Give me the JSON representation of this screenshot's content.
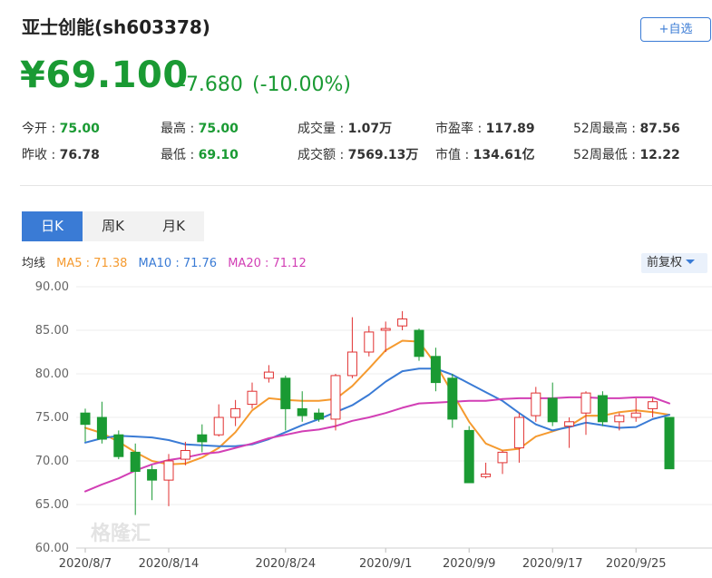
{
  "header": {
    "title": "亚士创能(sh603378)",
    "add_button": "+自选",
    "price": "¥69.100",
    "change": "-7.680",
    "change_pct": "(-10.00%)"
  },
  "stats": {
    "open_label": "今开 :",
    "open": "75.00",
    "high_label": "最高 :",
    "high": "75.00",
    "volume_label": "成交量 :",
    "volume": "1.07万",
    "pe_label": "市盈率 :",
    "pe": "117.89",
    "w52high_label": "52周最高 :",
    "w52high": "87.56",
    "prev_label": "昨收 :",
    "prev": "76.78",
    "low_label": "最低 :",
    "low": "69.10",
    "amount_label": "成交额 :",
    "amount": "7569.13万",
    "mcap_label": "市值 :",
    "mcap": "134.61亿",
    "w52low_label": "52周最低 :",
    "w52low": "12.22"
  },
  "tabs": {
    "day": "日K",
    "week": "周K",
    "month": "月K"
  },
  "ma_legend": {
    "label": "均线",
    "ma5": "MA5 : 71.38",
    "ma10": "MA10 : 71.76",
    "ma20": "MA20 : 71.12"
  },
  "adjust_select": "前复权",
  "watermark": "格隆汇",
  "colors": {
    "up": "#e03030",
    "down": "#1a9a33",
    "ma5": "#f59a2f",
    "ma10": "#3a7bd5",
    "ma20": "#d23fb5",
    "accent": "#3a7bd5"
  },
  "chart_data": {
    "type": "candlestick",
    "ylim": [
      60,
      90
    ],
    "yticks": [
      "90.00",
      "85.00",
      "80.00",
      "75.00",
      "70.00",
      "65.00",
      "60.00"
    ],
    "xtick_labels": [
      "2020/8/7",
      "2020/8/14",
      "2020/8/24",
      "2020/9/1",
      "2020/9/9",
      "2020/9/17",
      "2020/9/25"
    ],
    "xtick_index": [
      0,
      5,
      12,
      18,
      23,
      28,
      33
    ],
    "candles": [
      {
        "o": 75.5,
        "h": 76.0,
        "l": 72.2,
        "c": 74.2
      },
      {
        "o": 75.0,
        "h": 76.8,
        "l": 72.0,
        "c": 72.5
      },
      {
        "o": 73.0,
        "h": 73.5,
        "l": 70.2,
        "c": 70.5
      },
      {
        "o": 71.0,
        "h": 72.0,
        "l": 63.8,
        "c": 68.8
      },
      {
        "o": 69.0,
        "h": 69.5,
        "l": 65.5,
        "c": 67.8
      },
      {
        "o": 67.8,
        "h": 70.8,
        "l": 64.8,
        "c": 70.0
      },
      {
        "o": 70.2,
        "h": 72.2,
        "l": 69.5,
        "c": 71.2
      },
      {
        "o": 73.0,
        "h": 74.2,
        "l": 71.0,
        "c": 72.2
      },
      {
        "o": 73.0,
        "h": 76.5,
        "l": 72.8,
        "c": 75.0
      },
      {
        "o": 75.0,
        "h": 77.0,
        "l": 74.0,
        "c": 76.0
      },
      {
        "o": 76.5,
        "h": 79.0,
        "l": 76.0,
        "c": 78.0
      },
      {
        "o": 79.5,
        "h": 81.0,
        "l": 79.0,
        "c": 80.2
      },
      {
        "o": 79.5,
        "h": 79.8,
        "l": 73.5,
        "c": 76.0
      },
      {
        "o": 76.0,
        "h": 78.0,
        "l": 74.5,
        "c": 75.2
      },
      {
        "o": 75.5,
        "h": 76.0,
        "l": 74.5,
        "c": 74.8
      },
      {
        "o": 74.8,
        "h": 80.0,
        "l": 73.5,
        "c": 79.8
      },
      {
        "o": 79.8,
        "h": 86.5,
        "l": 79.5,
        "c": 82.5
      },
      {
        "o": 82.5,
        "h": 85.5,
        "l": 82.0,
        "c": 84.8
      },
      {
        "o": 85.0,
        "h": 86.0,
        "l": 82.5,
        "c": 85.2
      },
      {
        "o": 85.5,
        "h": 87.2,
        "l": 85.0,
        "c": 86.3
      },
      {
        "o": 85.0,
        "h": 85.2,
        "l": 81.5,
        "c": 82.0
      },
      {
        "o": 82.0,
        "h": 83.0,
        "l": 78.0,
        "c": 79.0
      },
      {
        "o": 79.5,
        "h": 80.0,
        "l": 73.8,
        "c": 74.8
      },
      {
        "o": 73.5,
        "h": 74.0,
        "l": 67.5,
        "c": 67.5
      },
      {
        "o": 68.2,
        "h": 69.8,
        "l": 68.0,
        "c": 68.5
      },
      {
        "o": 69.8,
        "h": 71.2,
        "l": 68.5,
        "c": 71.0
      },
      {
        "o": 71.5,
        "h": 75.5,
        "l": 69.8,
        "c": 75.0
      },
      {
        "o": 75.2,
        "h": 78.5,
        "l": 74.5,
        "c": 77.8
      },
      {
        "o": 77.2,
        "h": 79.0,
        "l": 74.0,
        "c": 74.5
      },
      {
        "o": 74.0,
        "h": 75.0,
        "l": 71.5,
        "c": 74.5
      },
      {
        "o": 75.5,
        "h": 78.0,
        "l": 73.0,
        "c": 77.8
      },
      {
        "o": 77.5,
        "h": 78.0,
        "l": 74.0,
        "c": 74.5
      },
      {
        "o": 74.5,
        "h": 75.5,
        "l": 73.5,
        "c": 75.2
      },
      {
        "o": 75.0,
        "h": 77.2,
        "l": 74.5,
        "c": 75.5
      },
      {
        "o": 76.0,
        "h": 77.2,
        "l": 75.0,
        "c": 76.8
      },
      {
        "o": 75.0,
        "h": 75.0,
        "l": 69.1,
        "c": 69.1
      }
    ],
    "series": [
      {
        "name": "MA5",
        "values": [
          73.8,
          73.2,
          72.2,
          71.0,
          70.0,
          69.6,
          69.7,
          70.4,
          71.5,
          73.3,
          75.8,
          77.2,
          77.0,
          76.9,
          76.9,
          77.1,
          78.6,
          80.6,
          82.7,
          83.8,
          83.7,
          81.1,
          77.8,
          74.5,
          72.0,
          71.2,
          71.4,
          72.8,
          73.4,
          74.0,
          75.2,
          75.2,
          75.6,
          75.8,
          75.6,
          75.3
        ]
      },
      {
        "name": "MA10",
        "values": [
          72.1,
          72.6,
          72.9,
          72.8,
          72.7,
          72.4,
          71.9,
          71.8,
          71.7,
          71.7,
          71.9,
          72.5,
          73.3,
          74.1,
          74.8,
          75.6,
          76.4,
          77.6,
          79.1,
          80.3,
          80.6,
          80.6,
          79.9,
          78.9,
          77.9,
          76.9,
          75.5,
          74.2,
          73.5,
          73.9,
          74.4,
          74.1,
          73.8,
          73.9,
          74.8,
          75.3
        ]
      },
      {
        "name": "MA20",
        "values": [
          66.5,
          67.3,
          68.0,
          68.9,
          69.6,
          70.1,
          70.4,
          70.8,
          71.0,
          71.5,
          72.0,
          72.6,
          73.0,
          73.4,
          73.6,
          74.0,
          74.6,
          75.0,
          75.5,
          76.1,
          76.6,
          76.7,
          76.8,
          76.9,
          76.9,
          77.1,
          77.2,
          77.2,
          77.2,
          77.3,
          77.3,
          77.2,
          77.2,
          77.3,
          77.3,
          76.6
        ]
      }
    ]
  }
}
